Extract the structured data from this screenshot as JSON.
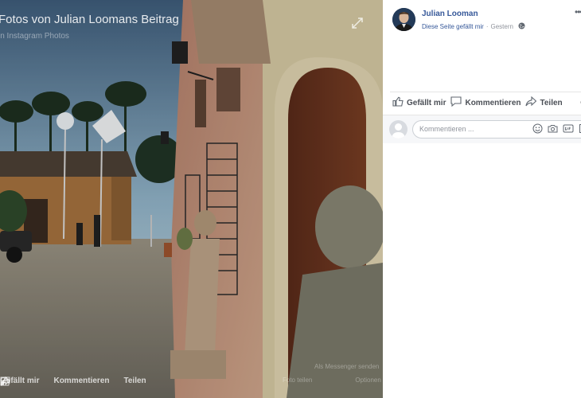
{
  "photo": {
    "title": "Fotos von Julian Loomans Beitrag",
    "subtitle": "in Instagram Photos",
    "expand_icon": "expand-icon",
    "actions": [
      {
        "label": "Gefällt mir",
        "icon": "like-icon"
      },
      {
        "label": "Kommentieren",
        "icon": "comment-icon"
      },
      {
        "label": "Teilen",
        "icon": "share-icon"
      }
    ],
    "extra_links": {
      "send": "Als Messenger senden",
      "fullscreen": "Foto teilen",
      "options": "Optionen"
    }
  },
  "post": {
    "author": "Julian Looman",
    "like_page": "Diese Seite gefällt mir",
    "separator": "·",
    "timestamp": "Gestern",
    "privacy_icon": "globe-icon",
    "more_icon": "more-options-icon"
  },
  "actions": {
    "like": "Gefällt mir",
    "comment": "Kommentieren",
    "share": "Teilen"
  },
  "comment": {
    "placeholder": "Kommentieren ...",
    "icons": [
      "emoji-icon",
      "camera-icon",
      "gif-icon",
      "sticker-icon"
    ]
  },
  "colors": {
    "link": "#365899",
    "secondary_text": "#90949c",
    "action_text": "#4b4f56",
    "divider": "#e5e5e5",
    "comment_bg": "#f6f7f9"
  }
}
